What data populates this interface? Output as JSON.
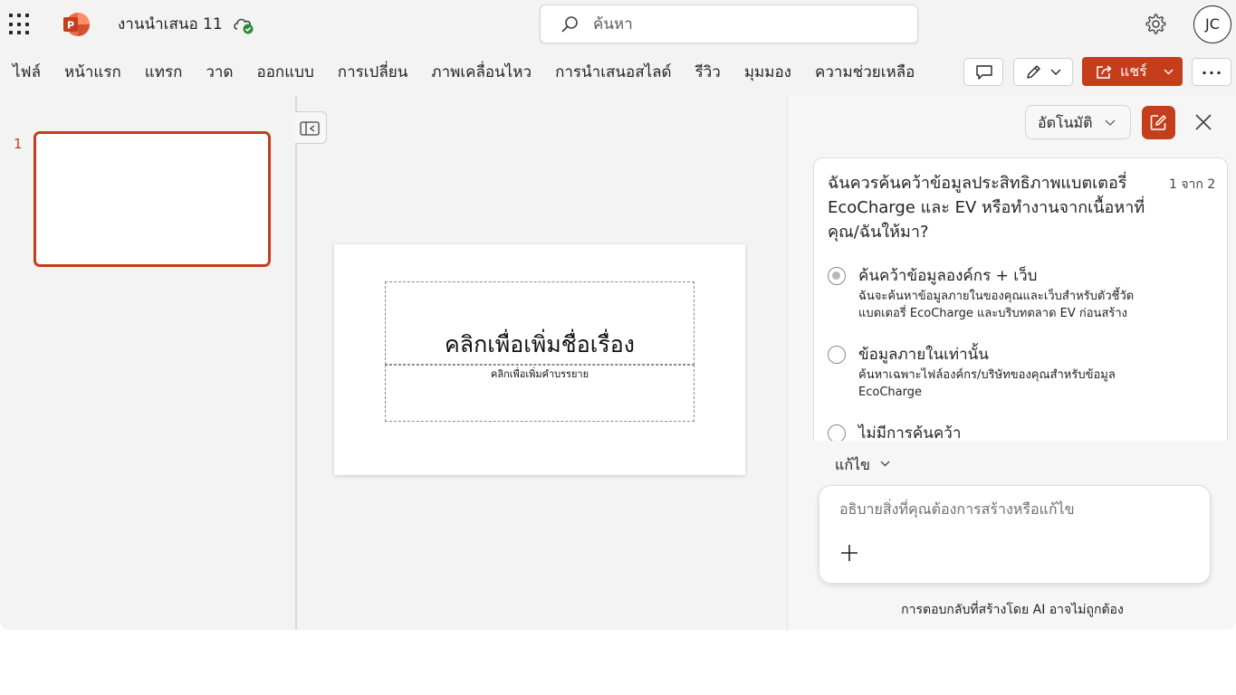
{
  "titlebar": {
    "app_icon": "powerpoint-logo",
    "document_title": "งานนำเสนอ 11",
    "sync_icon": "cloud-saved-icon",
    "search_placeholder": "ค้นหา",
    "avatar_initials": "JC"
  },
  "ribbon": {
    "tabs": [
      "ไฟล์",
      "หน้าแรก",
      "แทรก",
      "วาด",
      "ออกแบบ",
      "การเปลี่ยน",
      "ภาพเคลื่อนไหว",
      "การนำเสนอสไลด์",
      "รีวิว",
      "มุมมอง",
      "ความช่วยเหลือ"
    ],
    "share_label": "แชร์"
  },
  "slides_panel": {
    "slides": [
      {
        "number": "1"
      }
    ]
  },
  "slide": {
    "title_placeholder": "คลิกเพื่อเพิ่มชื่อเรื่อง",
    "subtitle_placeholder": "คลิกเพื่อเพิ่มคำบรรยาย"
  },
  "copilot": {
    "mode_label": "อัตโนมัติ",
    "question": "ฉันควรค้นคว้าข้อมูลประสิทธิภาพแบตเตอรี่ EcoCharge และ EV หรือทำงานจากเนื้อหาที่คุณ/ฉันให้มา?",
    "counter": "1 จาก 2",
    "options": [
      {
        "title": "ค้นคว้าข้อมูลองค์กร + เว็บ",
        "desc": "ฉันจะค้นหาข้อมูลภายในของคุณและเว็บสำหรับตัวชี้วัดแบตเตอรี่ EcoCharge และบริบทตลาด EV ก่อนสร้าง",
        "selected": true
      },
      {
        "title": "ข้อมูลภายในเท่านั้น",
        "desc": "ค้นหาเฉพาะไฟล์องค์กร/บริษัทของคุณสำหรับข้อมูล EcoCharge",
        "selected": false
      },
      {
        "title": "ไม่มีการค้นคว้า",
        "desc": "",
        "selected": false
      }
    ],
    "edit_label": "แก้ไข",
    "composer_placeholder": "อธิบายสิ่งที่คุณต้องการสร้างหรือแก้ไข",
    "disclaimer": "การตอบกลับที่สร้างโดย AI อาจไม่ถูกต้อง",
    "accent_color": "#c43e1c"
  }
}
